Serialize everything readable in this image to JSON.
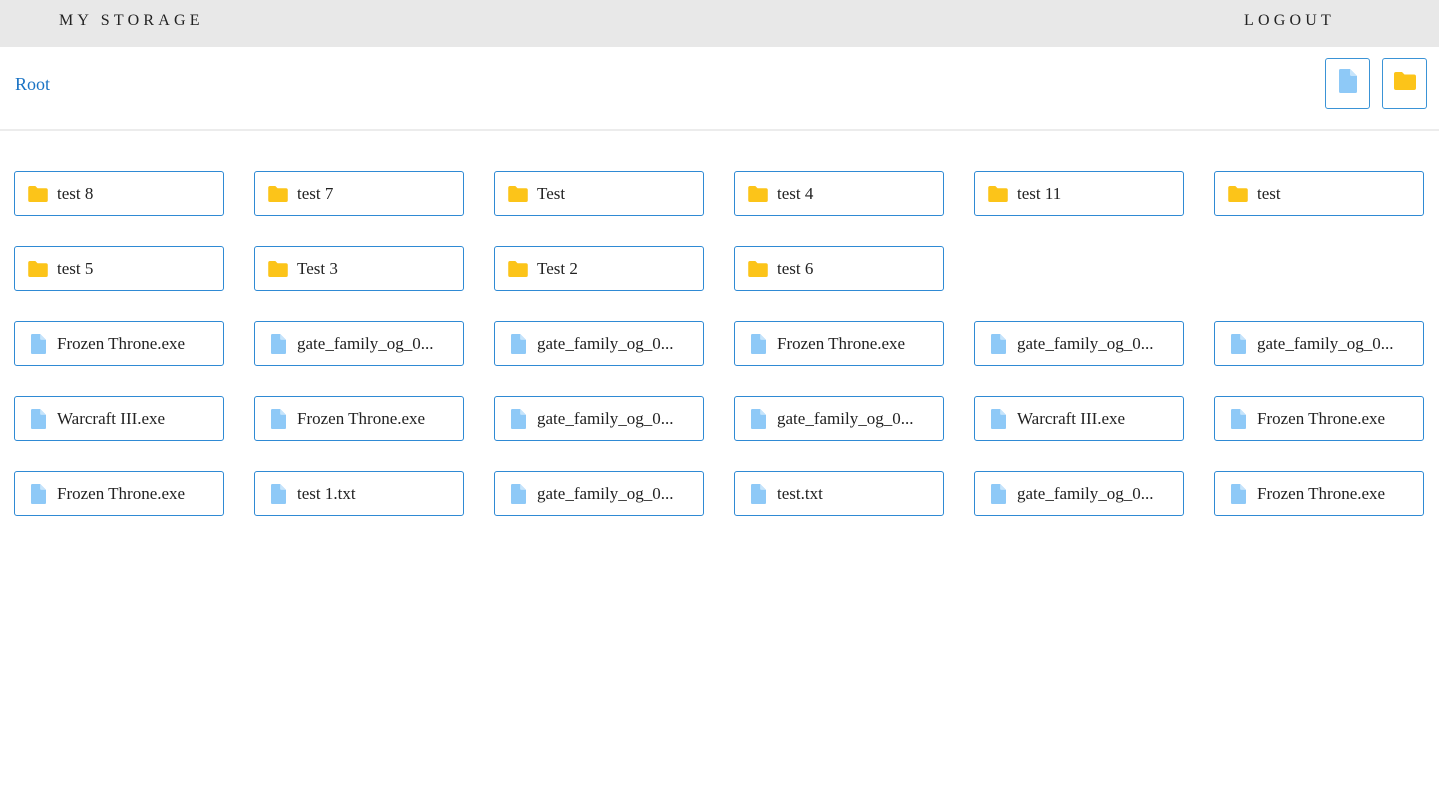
{
  "header": {
    "brand": "MY STORAGE",
    "logout_label": "LOGOUT"
  },
  "toolbar": {
    "breadcrumb": "Root",
    "new_file_icon": "file-icon",
    "new_folder_icon": "folder-icon"
  },
  "colors": {
    "folder": "#fcc419",
    "file": "#8ec9f7",
    "accent": "#2f8ad4",
    "link": "#1a73c4"
  },
  "folders": [
    "test 8",
    "test 7",
    "Test",
    "test 4",
    "test 11",
    "test",
    "test 5",
    "Test 3",
    "Test 2",
    "test 6"
  ],
  "files": [
    "Frozen Throne.exe",
    "gate_family_og_0...",
    "gate_family_og_0...",
    "Frozen Throne.exe",
    "gate_family_og_0...",
    "gate_family_og_0...",
    "Warcraft III.exe",
    "Frozen Throne.exe",
    "gate_family_og_0...",
    "gate_family_og_0...",
    "Warcraft III.exe",
    "Frozen Throne.exe",
    "Frozen Throne.exe",
    "test 1.txt",
    "gate_family_og_0...",
    "test.txt",
    "gate_family_og_0...",
    "Frozen Throne.exe"
  ]
}
